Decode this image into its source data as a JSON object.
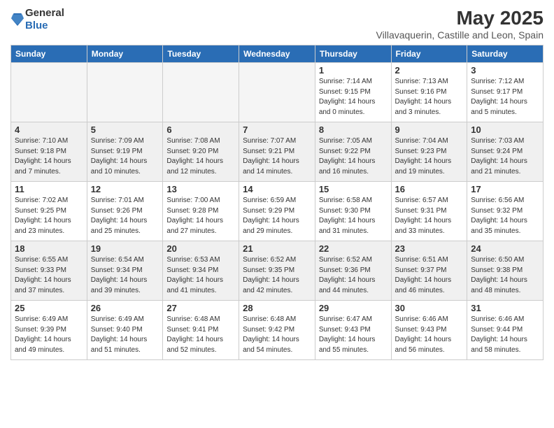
{
  "header": {
    "logo_general": "General",
    "logo_blue": "Blue",
    "month": "May 2025",
    "location": "Villavaquerin, Castille and Leon, Spain"
  },
  "days_of_week": [
    "Sunday",
    "Monday",
    "Tuesday",
    "Wednesday",
    "Thursday",
    "Friday",
    "Saturday"
  ],
  "weeks": [
    {
      "alt": false,
      "days": [
        {
          "num": "",
          "info": "",
          "empty": true
        },
        {
          "num": "",
          "info": "",
          "empty": true
        },
        {
          "num": "",
          "info": "",
          "empty": true
        },
        {
          "num": "",
          "info": "",
          "empty": true
        },
        {
          "num": "1",
          "info": "Sunrise: 7:14 AM\nSunset: 9:15 PM\nDaylight: 14 hours\nand 0 minutes.",
          "empty": false
        },
        {
          "num": "2",
          "info": "Sunrise: 7:13 AM\nSunset: 9:16 PM\nDaylight: 14 hours\nand 3 minutes.",
          "empty": false
        },
        {
          "num": "3",
          "info": "Sunrise: 7:12 AM\nSunset: 9:17 PM\nDaylight: 14 hours\nand 5 minutes.",
          "empty": false
        }
      ]
    },
    {
      "alt": true,
      "days": [
        {
          "num": "4",
          "info": "Sunrise: 7:10 AM\nSunset: 9:18 PM\nDaylight: 14 hours\nand 7 minutes.",
          "empty": false
        },
        {
          "num": "5",
          "info": "Sunrise: 7:09 AM\nSunset: 9:19 PM\nDaylight: 14 hours\nand 10 minutes.",
          "empty": false
        },
        {
          "num": "6",
          "info": "Sunrise: 7:08 AM\nSunset: 9:20 PM\nDaylight: 14 hours\nand 12 minutes.",
          "empty": false
        },
        {
          "num": "7",
          "info": "Sunrise: 7:07 AM\nSunset: 9:21 PM\nDaylight: 14 hours\nand 14 minutes.",
          "empty": false
        },
        {
          "num": "8",
          "info": "Sunrise: 7:05 AM\nSunset: 9:22 PM\nDaylight: 14 hours\nand 16 minutes.",
          "empty": false
        },
        {
          "num": "9",
          "info": "Sunrise: 7:04 AM\nSunset: 9:23 PM\nDaylight: 14 hours\nand 19 minutes.",
          "empty": false
        },
        {
          "num": "10",
          "info": "Sunrise: 7:03 AM\nSunset: 9:24 PM\nDaylight: 14 hours\nand 21 minutes.",
          "empty": false
        }
      ]
    },
    {
      "alt": false,
      "days": [
        {
          "num": "11",
          "info": "Sunrise: 7:02 AM\nSunset: 9:25 PM\nDaylight: 14 hours\nand 23 minutes.",
          "empty": false
        },
        {
          "num": "12",
          "info": "Sunrise: 7:01 AM\nSunset: 9:26 PM\nDaylight: 14 hours\nand 25 minutes.",
          "empty": false
        },
        {
          "num": "13",
          "info": "Sunrise: 7:00 AM\nSunset: 9:28 PM\nDaylight: 14 hours\nand 27 minutes.",
          "empty": false
        },
        {
          "num": "14",
          "info": "Sunrise: 6:59 AM\nSunset: 9:29 PM\nDaylight: 14 hours\nand 29 minutes.",
          "empty": false
        },
        {
          "num": "15",
          "info": "Sunrise: 6:58 AM\nSunset: 9:30 PM\nDaylight: 14 hours\nand 31 minutes.",
          "empty": false
        },
        {
          "num": "16",
          "info": "Sunrise: 6:57 AM\nSunset: 9:31 PM\nDaylight: 14 hours\nand 33 minutes.",
          "empty": false
        },
        {
          "num": "17",
          "info": "Sunrise: 6:56 AM\nSunset: 9:32 PM\nDaylight: 14 hours\nand 35 minutes.",
          "empty": false
        }
      ]
    },
    {
      "alt": true,
      "days": [
        {
          "num": "18",
          "info": "Sunrise: 6:55 AM\nSunset: 9:33 PM\nDaylight: 14 hours\nand 37 minutes.",
          "empty": false
        },
        {
          "num": "19",
          "info": "Sunrise: 6:54 AM\nSunset: 9:34 PM\nDaylight: 14 hours\nand 39 minutes.",
          "empty": false
        },
        {
          "num": "20",
          "info": "Sunrise: 6:53 AM\nSunset: 9:34 PM\nDaylight: 14 hours\nand 41 minutes.",
          "empty": false
        },
        {
          "num": "21",
          "info": "Sunrise: 6:52 AM\nSunset: 9:35 PM\nDaylight: 14 hours\nand 42 minutes.",
          "empty": false
        },
        {
          "num": "22",
          "info": "Sunrise: 6:52 AM\nSunset: 9:36 PM\nDaylight: 14 hours\nand 44 minutes.",
          "empty": false
        },
        {
          "num": "23",
          "info": "Sunrise: 6:51 AM\nSunset: 9:37 PM\nDaylight: 14 hours\nand 46 minutes.",
          "empty": false
        },
        {
          "num": "24",
          "info": "Sunrise: 6:50 AM\nSunset: 9:38 PM\nDaylight: 14 hours\nand 48 minutes.",
          "empty": false
        }
      ]
    },
    {
      "alt": false,
      "days": [
        {
          "num": "25",
          "info": "Sunrise: 6:49 AM\nSunset: 9:39 PM\nDaylight: 14 hours\nand 49 minutes.",
          "empty": false
        },
        {
          "num": "26",
          "info": "Sunrise: 6:49 AM\nSunset: 9:40 PM\nDaylight: 14 hours\nand 51 minutes.",
          "empty": false
        },
        {
          "num": "27",
          "info": "Sunrise: 6:48 AM\nSunset: 9:41 PM\nDaylight: 14 hours\nand 52 minutes.",
          "empty": false
        },
        {
          "num": "28",
          "info": "Sunrise: 6:48 AM\nSunset: 9:42 PM\nDaylight: 14 hours\nand 54 minutes.",
          "empty": false
        },
        {
          "num": "29",
          "info": "Sunrise: 6:47 AM\nSunset: 9:43 PM\nDaylight: 14 hours\nand 55 minutes.",
          "empty": false
        },
        {
          "num": "30",
          "info": "Sunrise: 6:46 AM\nSunset: 9:43 PM\nDaylight: 14 hours\nand 56 minutes.",
          "empty": false
        },
        {
          "num": "31",
          "info": "Sunrise: 6:46 AM\nSunset: 9:44 PM\nDaylight: 14 hours\nand 58 minutes.",
          "empty": false
        }
      ]
    }
  ]
}
